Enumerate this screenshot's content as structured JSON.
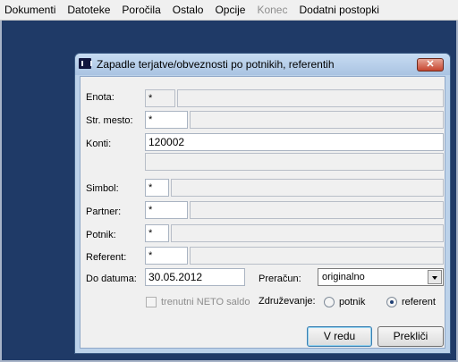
{
  "menu": {
    "items": [
      {
        "label": "Dokumenti",
        "disabled": false
      },
      {
        "label": "Datoteke",
        "disabled": false
      },
      {
        "label": "Poročila",
        "disabled": false
      },
      {
        "label": "Ostalo",
        "disabled": false
      },
      {
        "label": "Opcije",
        "disabled": false
      },
      {
        "label": "Konec",
        "disabled": true
      },
      {
        "label": "Dodatni postopki",
        "disabled": false
      }
    ]
  },
  "dialog": {
    "title": "Zapadle terjatve/obveznosti po potnikih, referentih",
    "close_glyph": "✕",
    "labels": {
      "enota": "Enota:",
      "str_mesto": "Str. mesto:",
      "konti": "Konti:",
      "simbol": "Simbol:",
      "partner": "Partner:",
      "potnik": "Potnik:",
      "referent": "Referent:",
      "do_datuma": "Do datuma:",
      "preracun": "Preračun:",
      "zdruzevanje": "Združevanje:"
    },
    "values": {
      "enota_code": "*",
      "enota_name": "",
      "str_mesto_code": "*",
      "str_mesto_name": "",
      "konti": "120002",
      "konti_extra": "",
      "simbol_code": "*",
      "simbol_name": "",
      "partner_code": "*",
      "partner_name": "",
      "potnik_code": "*",
      "potnik_name": "",
      "referent_code": "*",
      "referent_name": "",
      "do_datuma": "30.05.2012",
      "preracun_selected": "originalno"
    },
    "neto_checkbox": {
      "label": "trenutni NETO saldo",
      "checked": false,
      "disabled": true
    },
    "grouping": {
      "options": [
        {
          "label": "potnik",
          "selected": false
        },
        {
          "label": "referent",
          "selected": true
        }
      ]
    },
    "buttons": {
      "ok": "V redu",
      "cancel": "Prekliči"
    }
  },
  "colors": {
    "desktop": "#1f3a67",
    "dialog_frame": "#bcd2ea",
    "close_button": "#c6452f",
    "dialog_body": "#f0f0f0"
  }
}
